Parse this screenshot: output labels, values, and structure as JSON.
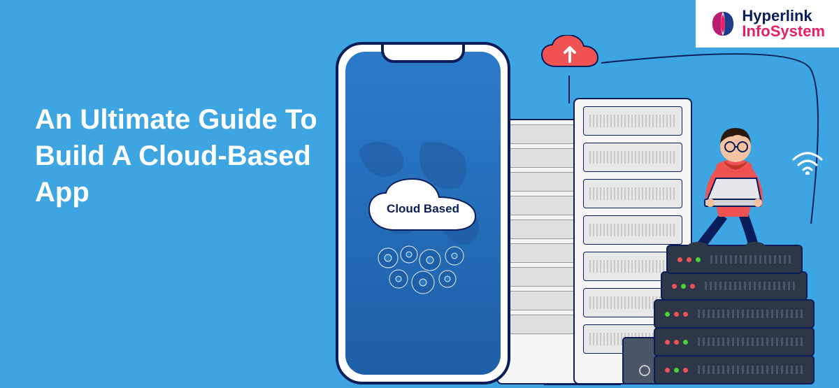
{
  "title": "An Ultimate Guide To Build A Cloud-Based App",
  "logo": {
    "text_top": "Hyperlink",
    "text_bottom": "InfoSystem"
  },
  "phone": {
    "cloud_label": "Cloud Based"
  },
  "colors": {
    "background": "#3ea5e3",
    "navy": "#0a1d5a",
    "red": "#ee5253",
    "pink": "#e91e63",
    "white": "#ffffff"
  }
}
